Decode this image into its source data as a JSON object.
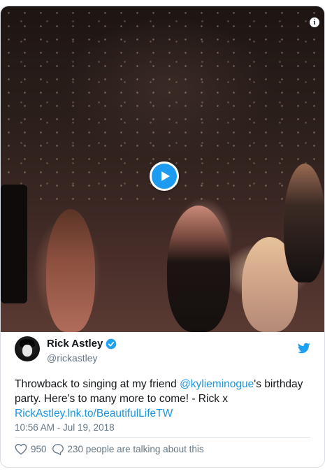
{
  "media": {
    "play_icon": "play-icon",
    "info_icon": "info-icon",
    "info_glyph": "i"
  },
  "author": {
    "name": "Rick Astley",
    "handle": "@rickastley",
    "verified_icon": "verified-badge-icon",
    "avatar_icon": "avatar"
  },
  "brand": {
    "logo_icon": "twitter-bird-icon",
    "accent_color": "#1da1f2",
    "link_color": "#1b95e0"
  },
  "tweet": {
    "text_before": "Throwback to singing at my friend ",
    "mention": "@kylieminogue",
    "text_after": "'s birthday party. Here's to many more to come! - Rick x ",
    "link": "RickAstley.lnk.to/BeautifulLifeTW",
    "timestamp": "10:56 AM - Jul 19, 2018"
  },
  "actions": {
    "like_icon": "heart-icon",
    "like_count": "950",
    "reply_icon": "speech-bubble-icon",
    "talking_text": "230 people are talking about this"
  }
}
